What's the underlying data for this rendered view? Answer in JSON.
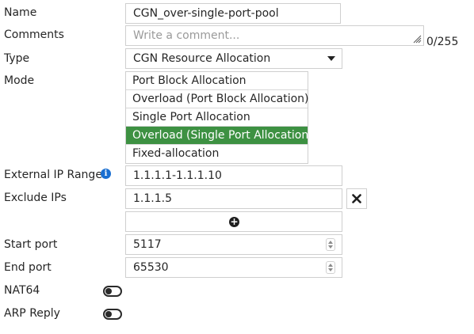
{
  "labels": {
    "name": "Name",
    "comments": "Comments",
    "type": "Type",
    "mode": "Mode",
    "external_ip_range": "External IP Range",
    "exclude_ips": "Exclude IPs",
    "start_port": "Start port",
    "end_port": "End port",
    "nat64": "NAT64",
    "arp_reply": "ARP Reply"
  },
  "fields": {
    "name_value": "CGN_over-single-port-pool",
    "comments_placeholder": "Write a comment...",
    "comments_counter": "0/255",
    "type_value": "CGN Resource Allocation",
    "external_ip_range_value": "1.1.1.1-1.1.1.10",
    "exclude_ip_value": "1.1.1.5",
    "start_port_value": "5117",
    "end_port_value": "65530"
  },
  "mode_options": [
    "Port Block Allocation",
    "Overload (Port Block Allocation)",
    "Single Port Allocation",
    "Overload (Single Port Allocation)",
    "Fixed-allocation"
  ],
  "mode_selected": "Overload (Single Port Allocation)",
  "toggles": {
    "nat64_enabled": false,
    "arp_reply_enabled": false
  },
  "icons": {
    "info": "info-icon",
    "remove": "close-icon",
    "add": "plus-circle-icon",
    "dropdown": "caret-down-icon"
  },
  "colors": {
    "selected_option_bg": "#3d9142",
    "info_icon": "#1a6fd1"
  }
}
